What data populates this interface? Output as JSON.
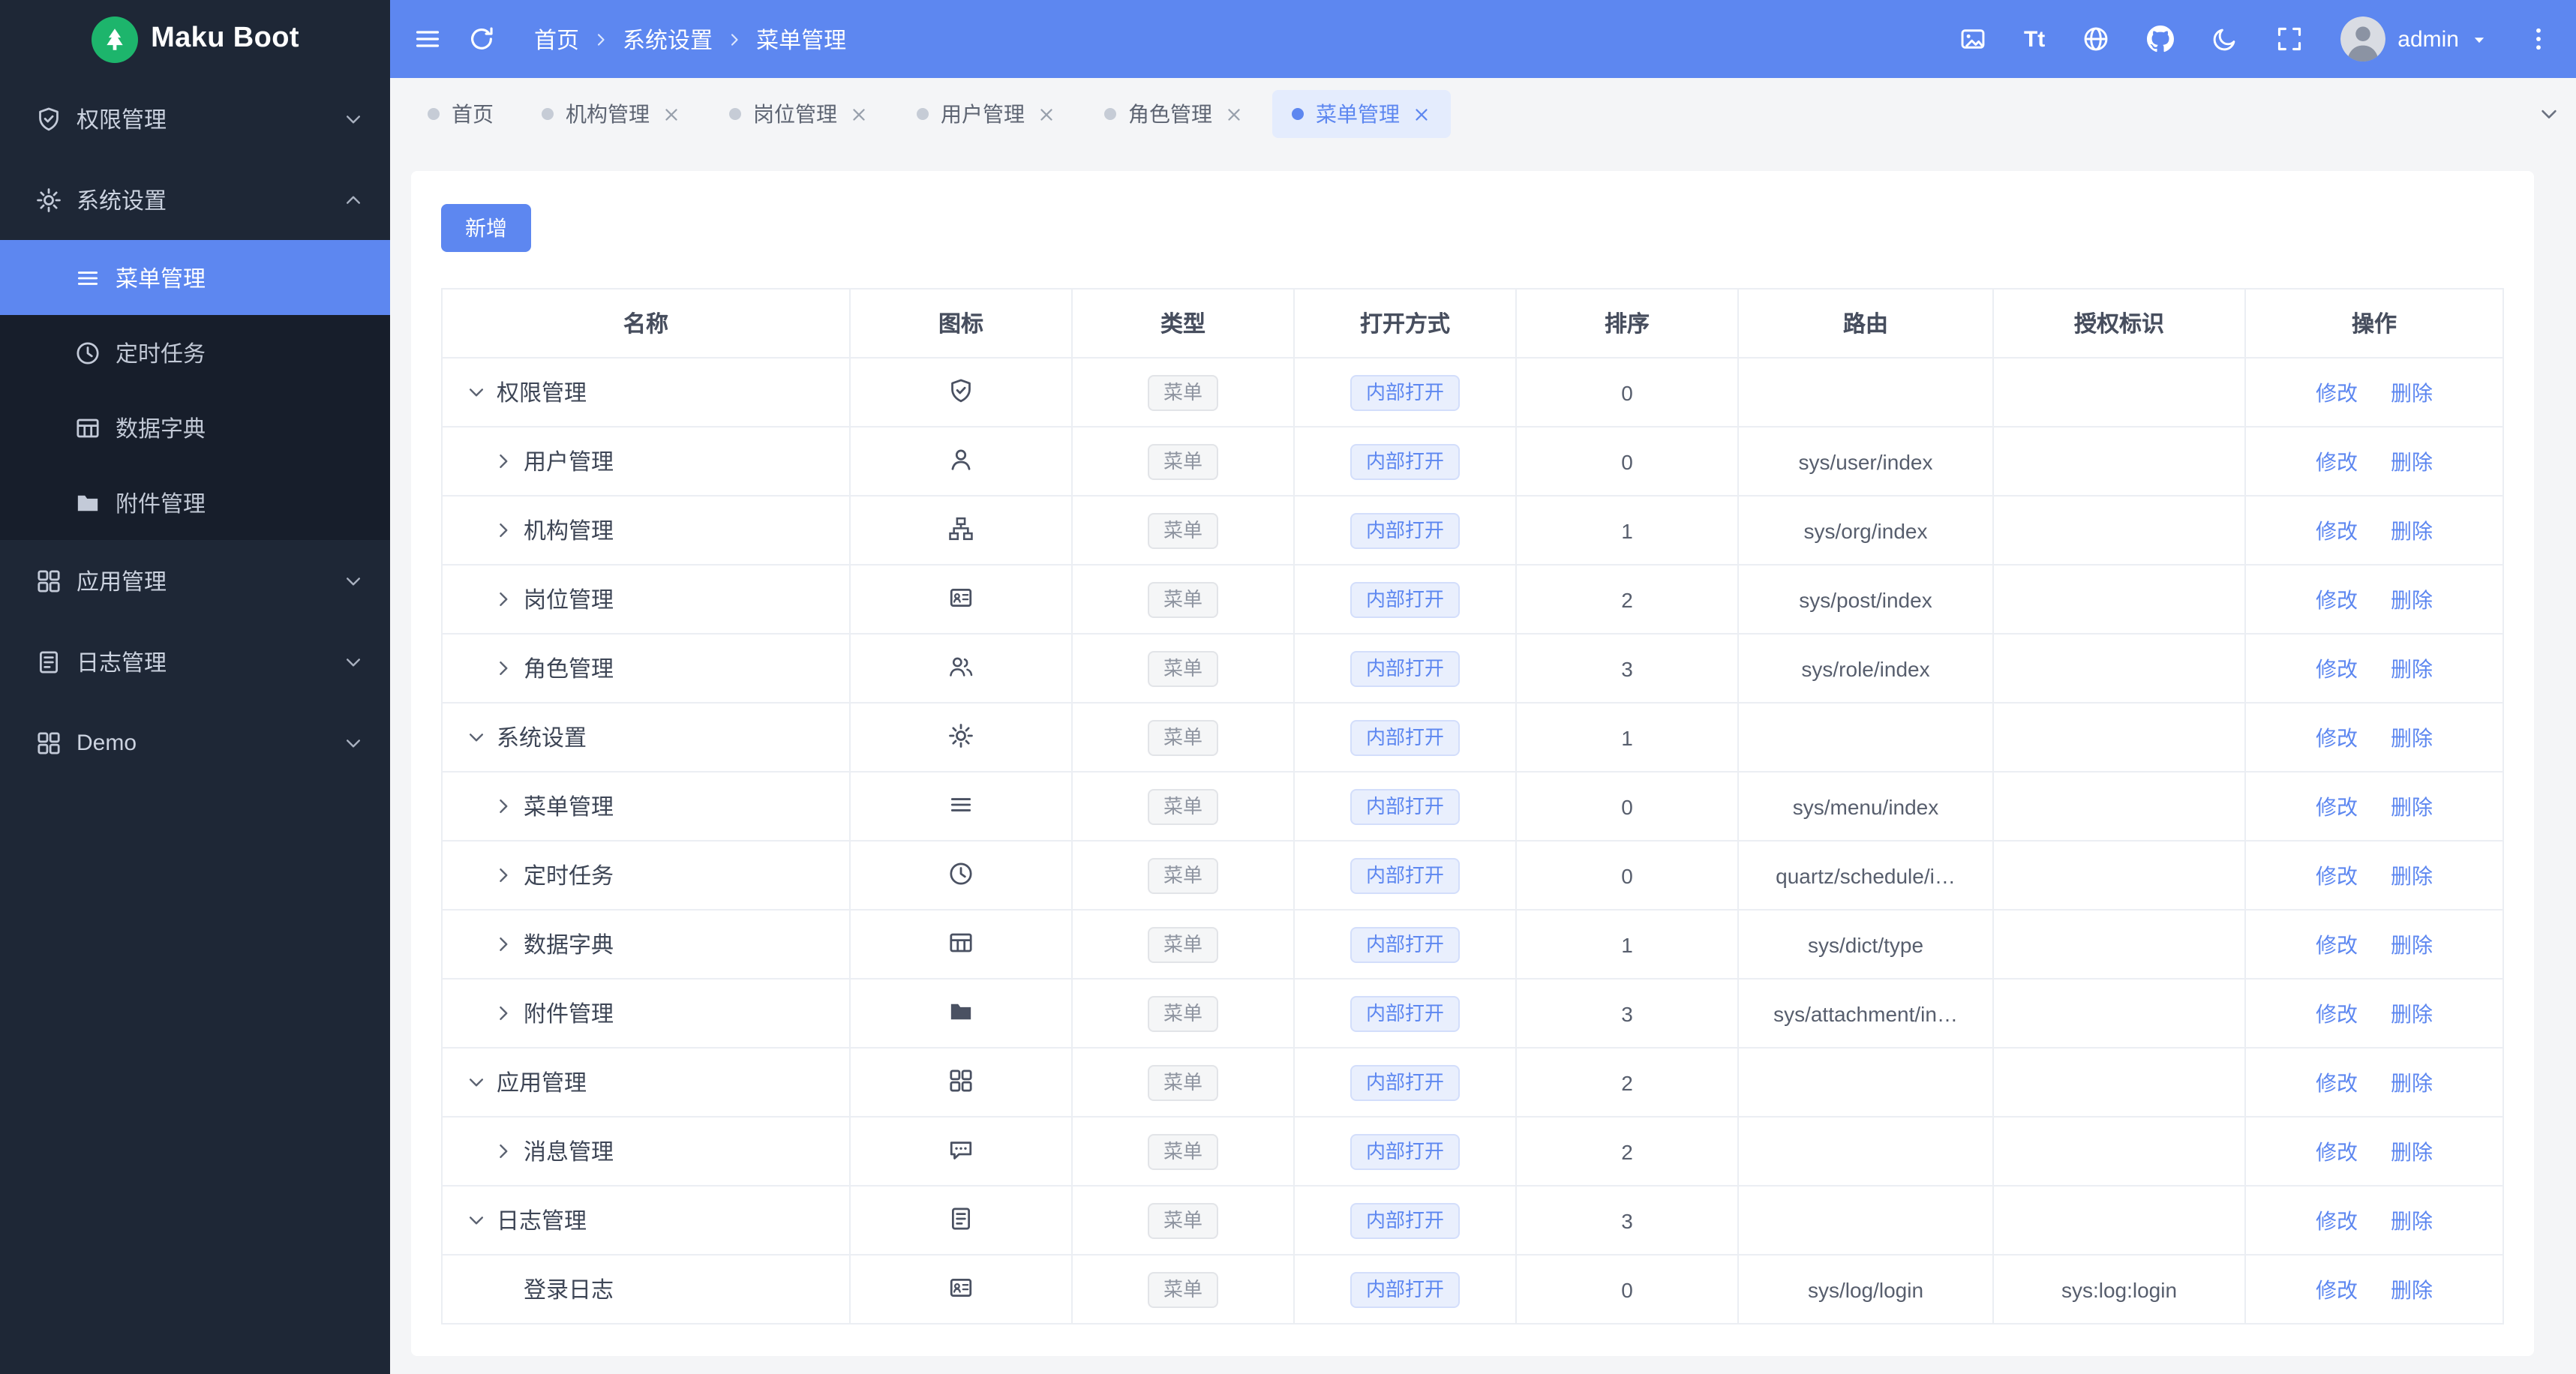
{
  "app": {
    "logo_text": "Maku Boot",
    "colors": {
      "accent": "#5d87f0",
      "header_bg": "#5d87f0",
      "sidebar_bg": "#1e2736",
      "submenu_bg": "#171e2b",
      "logo_green": "#1db56c",
      "content_bg": "#f4f5f7"
    }
  },
  "header": {
    "breadcrumb": [
      "首页",
      "系统设置",
      "菜单管理"
    ],
    "font_size_label": "Tt",
    "user": {
      "name": "admin"
    }
  },
  "sidebar": {
    "items": [
      {
        "key": "permission",
        "label": "权限管理",
        "icon": "shield",
        "expanded": false
      },
      {
        "key": "system",
        "label": "系统设置",
        "icon": "gear",
        "expanded": true,
        "children": [
          {
            "key": "menu",
            "label": "菜单管理",
            "icon": "menu",
            "active": true
          },
          {
            "key": "schedule",
            "label": "定时任务",
            "icon": "clock",
            "active": false
          },
          {
            "key": "dict",
            "label": "数据字典",
            "icon": "dict",
            "active": false
          },
          {
            "key": "attachment",
            "label": "附件管理",
            "icon": "folder",
            "active": false
          }
        ]
      },
      {
        "key": "application",
        "label": "应用管理",
        "icon": "apps",
        "expanded": false
      },
      {
        "key": "log",
        "label": "日志管理",
        "icon": "log",
        "expanded": false
      },
      {
        "key": "demo",
        "label": "Demo",
        "icon": "apps",
        "expanded": false
      }
    ]
  },
  "tabs": [
    {
      "key": "home",
      "label": "首页",
      "closable": false,
      "active": false
    },
    {
      "key": "org",
      "label": "机构管理",
      "closable": true,
      "active": false
    },
    {
      "key": "post",
      "label": "岗位管理",
      "closable": true,
      "active": false
    },
    {
      "key": "user",
      "label": "用户管理",
      "closable": true,
      "active": false
    },
    {
      "key": "role",
      "label": "角色管理",
      "closable": true,
      "active": false
    },
    {
      "key": "menu",
      "label": "菜单管理",
      "closable": true,
      "active": true
    }
  ],
  "toolbar": {
    "add_label": "新增"
  },
  "table": {
    "columns": [
      "名称",
      "图标",
      "类型",
      "打开方式",
      "排序",
      "路由",
      "授权标识",
      "操作"
    ],
    "type_tag": "菜单",
    "open_tag": "内部打开",
    "actions": [
      "修改",
      "删除"
    ],
    "rows": [
      {
        "name": "权限管理",
        "level": 0,
        "arrow": "down",
        "icon": "shield",
        "sort": "0",
        "route": "",
        "perm": ""
      },
      {
        "name": "用户管理",
        "level": 1,
        "arrow": "right",
        "icon": "user",
        "sort": "0",
        "route": "sys/user/index",
        "perm": ""
      },
      {
        "name": "机构管理",
        "level": 1,
        "arrow": "right",
        "icon": "org",
        "sort": "1",
        "route": "sys/org/index",
        "perm": ""
      },
      {
        "name": "岗位管理",
        "level": 1,
        "arrow": "right",
        "icon": "post",
        "sort": "2",
        "route": "sys/post/index",
        "perm": ""
      },
      {
        "name": "角色管理",
        "level": 1,
        "arrow": "right",
        "icon": "role",
        "sort": "3",
        "route": "sys/role/index",
        "perm": ""
      },
      {
        "name": "系统设置",
        "level": 0,
        "arrow": "down",
        "icon": "gear",
        "sort": "1",
        "route": "",
        "perm": ""
      },
      {
        "name": "菜单管理",
        "level": 1,
        "arrow": "right",
        "icon": "menu",
        "sort": "0",
        "route": "sys/menu/index",
        "perm": ""
      },
      {
        "name": "定时任务",
        "level": 1,
        "arrow": "right",
        "icon": "clock",
        "sort": "0",
        "route": "quartz/schedule/i…",
        "perm": ""
      },
      {
        "name": "数据字典",
        "level": 1,
        "arrow": "right",
        "icon": "dict",
        "sort": "1",
        "route": "sys/dict/type",
        "perm": ""
      },
      {
        "name": "附件管理",
        "level": 1,
        "arrow": "right",
        "icon": "folder",
        "sort": "3",
        "route": "sys/attachment/in…",
        "perm": ""
      },
      {
        "name": "应用管理",
        "level": 0,
        "arrow": "down",
        "icon": "apps",
        "sort": "2",
        "route": "",
        "perm": ""
      },
      {
        "name": "消息管理",
        "level": 1,
        "arrow": "right",
        "icon": "chat",
        "sort": "2",
        "route": "",
        "perm": ""
      },
      {
        "name": "日志管理",
        "level": 0,
        "arrow": "down",
        "icon": "log",
        "sort": "3",
        "route": "",
        "perm": ""
      },
      {
        "name": "登录日志",
        "level": 1,
        "arrow": "none",
        "icon": "post",
        "sort": "0",
        "route": "sys/log/login",
        "perm": "sys:log:login"
      }
    ]
  }
}
